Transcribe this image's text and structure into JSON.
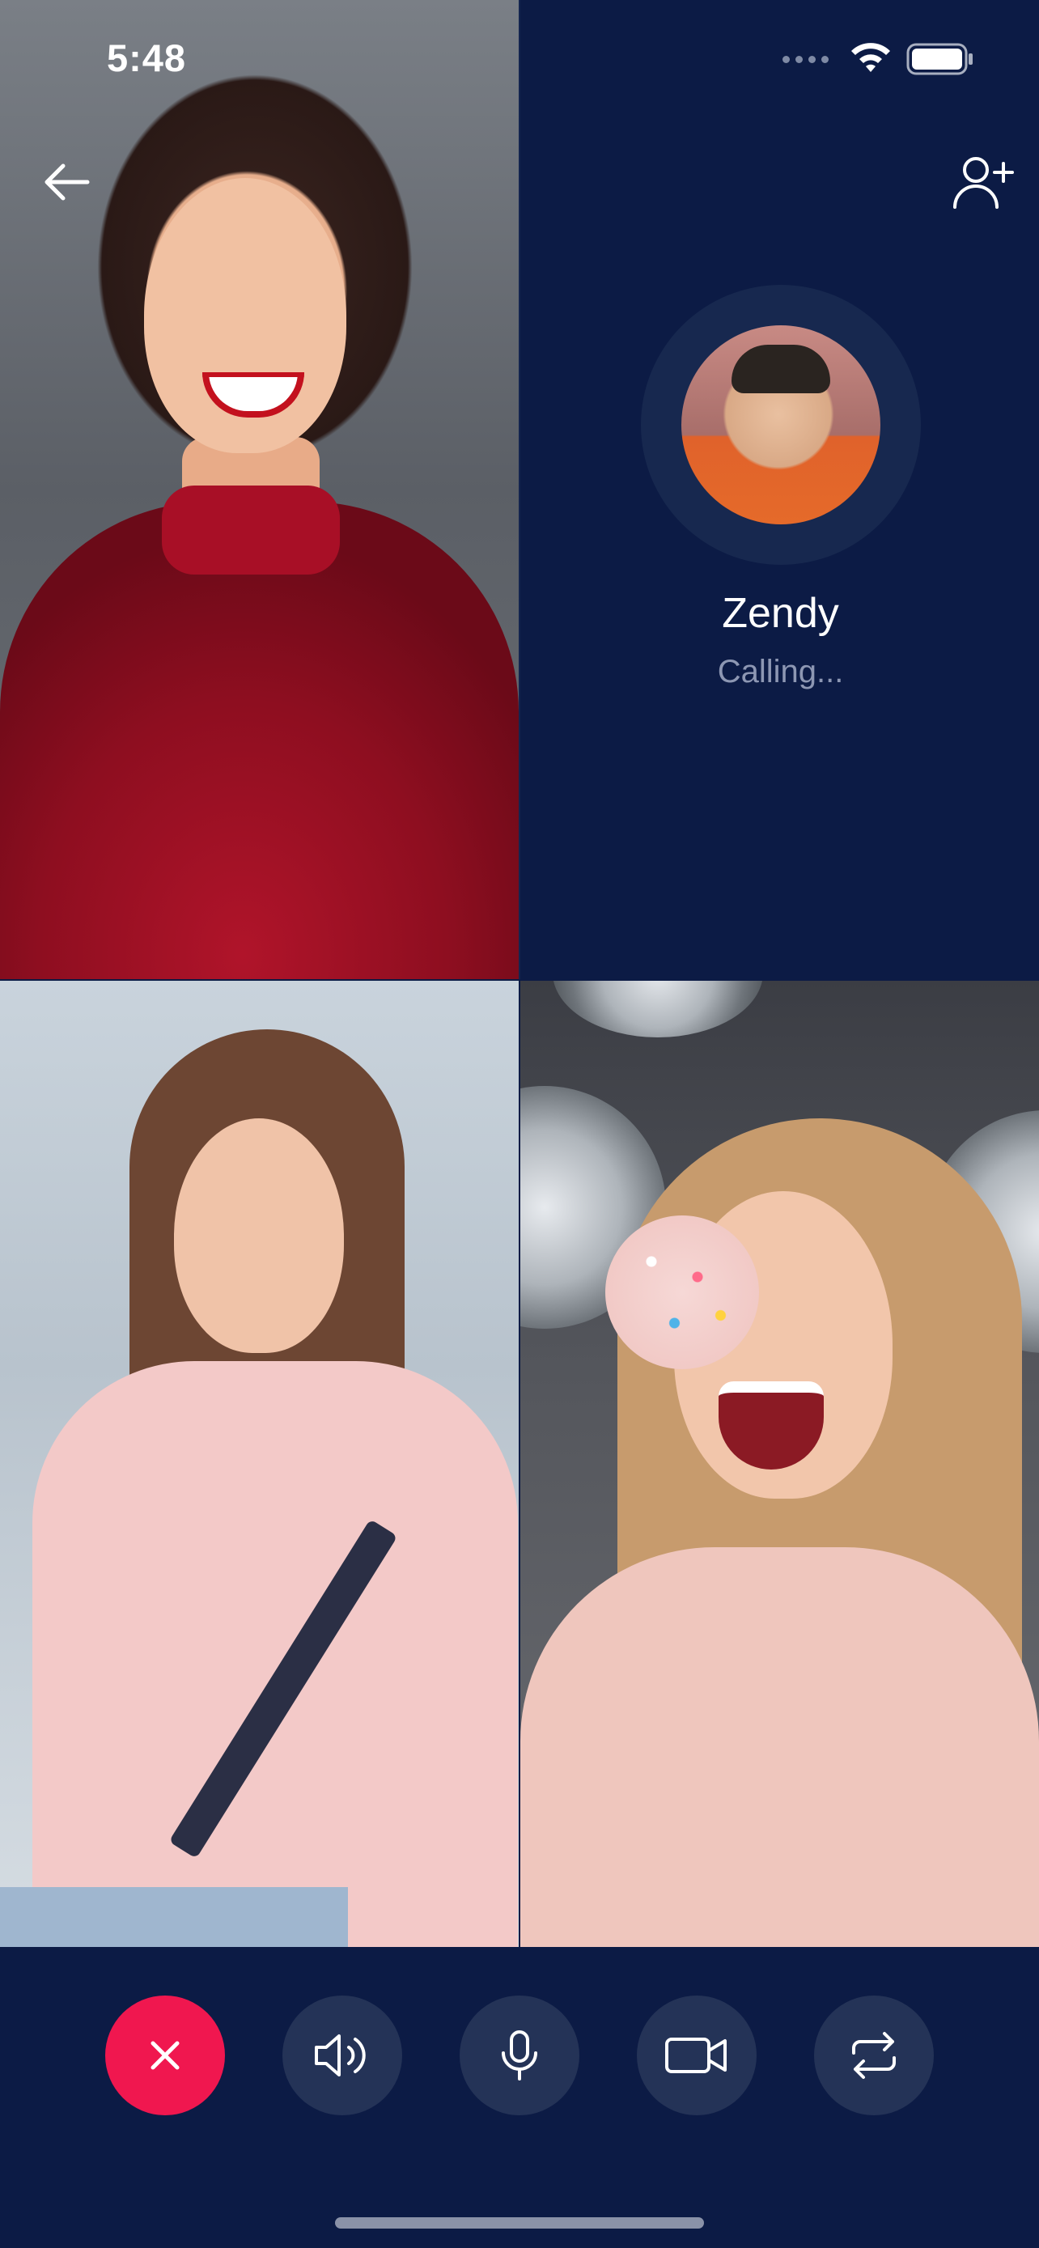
{
  "status_bar": {
    "time": "5:48"
  },
  "call": {
    "caller_name": "Zendy",
    "caller_status": "Calling..."
  },
  "participants": [
    {
      "name": "participant-top-left"
    },
    {
      "name": "participant-bottom-left"
    },
    {
      "name": "participant-bottom-right"
    }
  ],
  "controls": [
    {
      "name": "end-call",
      "icon": "close-icon",
      "color": "#f0174f"
    },
    {
      "name": "speaker",
      "icon": "speaker-icon"
    },
    {
      "name": "microphone",
      "icon": "microphone-icon"
    },
    {
      "name": "video",
      "icon": "video-camera-icon"
    },
    {
      "name": "switch-camera",
      "icon": "switch-camera-icon"
    }
  ],
  "colors": {
    "background": "#0c1b45",
    "control_bg": "#243357",
    "end_call": "#f0174f",
    "muted_text": "#8d97b3"
  }
}
